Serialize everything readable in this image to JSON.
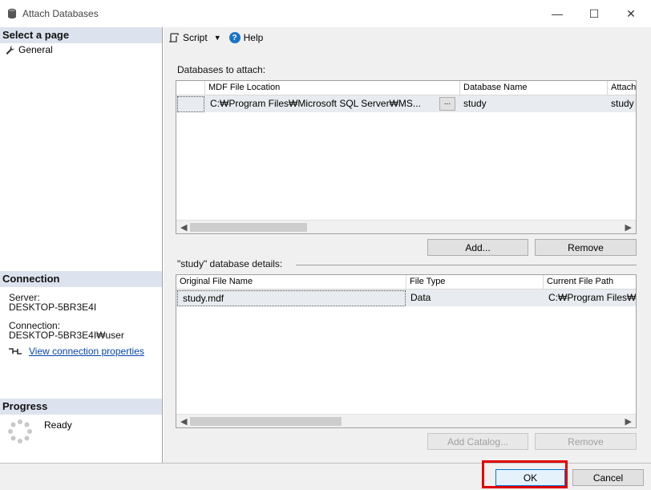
{
  "window": {
    "title": "Attach Databases",
    "controls": {
      "minimize": "—",
      "maximize": "☐",
      "close": "✕"
    }
  },
  "sidebar": {
    "select_page_header": "Select a page",
    "pages": [
      {
        "label": "General",
        "icon": "wrench-icon"
      }
    ],
    "connection": {
      "header": "Connection",
      "server_label": "Server:",
      "server_value": "DESKTOP-5BR3E4I",
      "connection_label": "Connection:",
      "connection_value": "DESKTOP-5BR3E4I₩user",
      "link": "View connection properties"
    },
    "progress": {
      "header": "Progress",
      "status": "Ready"
    }
  },
  "toolbar": {
    "script_label": "Script",
    "help_label": "Help"
  },
  "attach": {
    "group_label": "Databases to attach:",
    "columns": [
      "MDF File Location",
      "Database Name",
      "Attach"
    ],
    "rows": [
      {
        "mdf": "C:₩Program Files₩Microsoft SQL Server₩MS...",
        "browse": "...",
        "db_name": "study",
        "attach_as": "study"
      }
    ],
    "add_button": "Add...",
    "remove_button": "Remove"
  },
  "details": {
    "group_label": "\"study\" database details:",
    "columns": [
      "Original File Name",
      "File Type",
      "Current File Path"
    ],
    "rows": [
      {
        "name": "study.mdf",
        "type": "Data",
        "path": "C:₩Program Files₩"
      }
    ],
    "add_catalog_button": "Add Catalog...",
    "remove_button": "Remove"
  },
  "footer": {
    "ok_button": "OK",
    "cancel_button": "Cancel",
    "highlight_color": "#e00000"
  }
}
